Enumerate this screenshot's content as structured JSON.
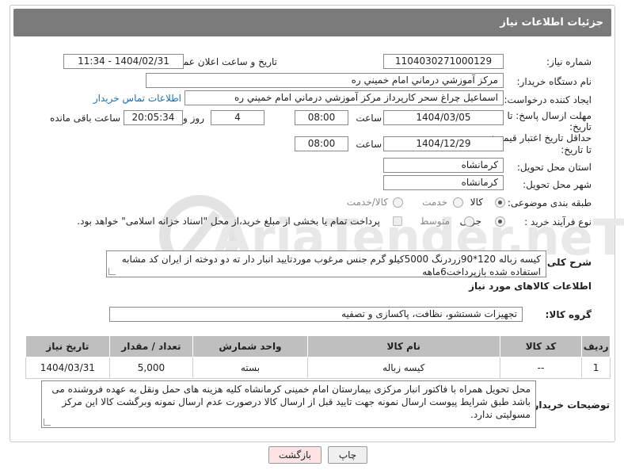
{
  "header": {
    "title": "جزئیات اطلاعات نیاز"
  },
  "fields": {
    "need_number_label": "شماره نیاز:",
    "need_number": "1104030271000129",
    "announce_label": "تاریخ و ساعت اعلان عمومی:",
    "announce_value": "1404/02/31 - 11:34",
    "buyer_org_label": "نام دستگاه خریدار:",
    "buyer_org": "مرکز آموزشي درماني امام خميني ره",
    "requester_label": "ایجاد کننده درخواست:",
    "requester": "اسماعيل چراغ سحر کارپرداز مرکز آموزشي درماني امام خميني ره",
    "contact_link": "اطلاعات تماس خریدار",
    "deadline_label_1": "مهلت ارسال پاسخ: تا",
    "deadline_label_2": "تاریخ:",
    "deadline_date": "1404/03/05",
    "time_label": "ساعت",
    "deadline_time": "08:00",
    "days_value": "4",
    "days_label": "روز و",
    "remaining_time": "20:05:34",
    "remaining_label": "ساعت باقی مانده",
    "validity_label_1": "حداقل تاریخ اعتبار قیمت:",
    "validity_label_2": "تا تاریخ:",
    "validity_date": "1404/12/29",
    "validity_time": "08:00",
    "province_label": "استان محل تحویل:",
    "province": "کرمانشاه",
    "city_label": "شهر محل تحویل:",
    "city": "کرمانشاه",
    "category_label": "طبقه بندی موضوعی:",
    "category_options": [
      "کالا",
      "خدمت",
      "کالا/خدمت"
    ],
    "category_selected": "کالا",
    "process_label": "نوع فرآیند خرید :",
    "process_options": [
      "جزیی",
      "متوسط"
    ],
    "process_selected": "جزیی",
    "payment_note": "پرداخت تمام یا بخشی از مبلغ خرید،از محل \"اسناد خزانه اسلامی\" خواهد بود."
  },
  "description": {
    "label": "شرح کلی نیاز:",
    "text": "کیسه زباله 120*90زردرنگ 5000کیلو گرم جنس مرغوب موردتایید انبار دار ته دو دوخته از ایران کد مشابه استفاده شده بازپرداخت6ماهه"
  },
  "goods": {
    "section_title": "اطلاعات کالاهای مورد نیاز",
    "group_label": "گروه کالا:",
    "group_value": "تجهیزات شستشو، نظافت، پاکسازی و تصفیه",
    "columns": [
      "ردیف",
      "کد کالا",
      "نام کالا",
      "واحد شمارش",
      "تعداد / مقدار",
      "تاریخ نیاز"
    ],
    "rows": [
      {
        "row": "1",
        "code": "--",
        "name": "کیسه زباله",
        "unit": "بسته",
        "qty": "5,000",
        "date": "1404/03/31"
      }
    ]
  },
  "buyer_notes": {
    "label": "توضیحات خریدار:",
    "text": "محل تحویل همراه با فاکتور انبار مرکزی بیمارستان امام خمینی کرمانشاه کلیه هزینه های حمل ونقل به عهده فروشنده می باشد طبق شرایط پیوست ارسال نمونه جهت تایید قبل از ارسال کالا درصورت عدم ارسال نمونه وبرگشت کالا این مرکز مسولیتی ندارد."
  },
  "buttons": {
    "print": "چاپ",
    "back": "بازگشت"
  },
  "watermark": {
    "text": "AriaTender.neT"
  },
  "colors": {
    "header_bg": "#7a7a7a",
    "link": "#1b6fb5",
    "table_head": "#bfbfbf",
    "back_btn": "#fde3e6"
  }
}
